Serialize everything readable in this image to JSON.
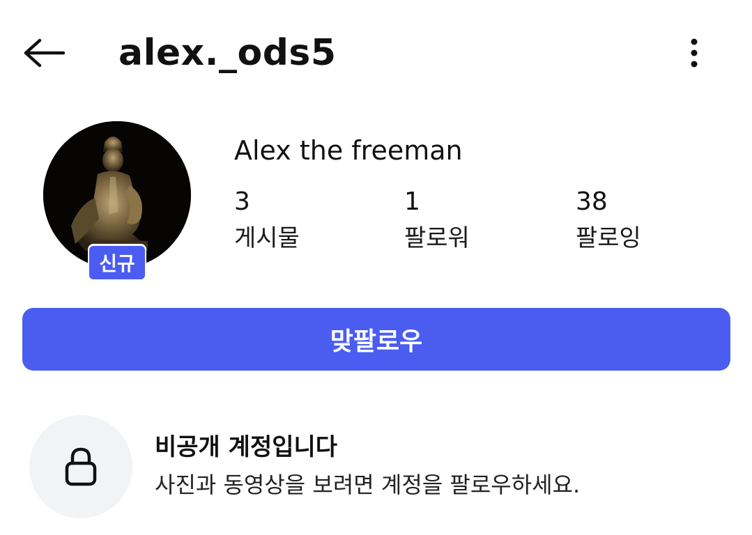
{
  "header": {
    "back_icon": "arrow-left-icon",
    "username": "alex._ods5",
    "more_icon": "vertical-ellipsis-icon"
  },
  "profile": {
    "display_name": "Alex the freeman",
    "new_badge": "신규",
    "stats": [
      {
        "count": "3",
        "label": "게시물"
      },
      {
        "count": "1",
        "label": "팔로워"
      },
      {
        "count": "38",
        "label": "팔로잉"
      }
    ]
  },
  "actions": {
    "follow_back_label": "맞팔로우"
  },
  "private_notice": {
    "icon": "lock-icon",
    "title": "비공개 계정입니다",
    "description": "사진과 동영상을 보려면 계정을 팔로우하세요."
  },
  "colors": {
    "accent": "#4a5df0",
    "lock_circle_bg": "#f2f3f4",
    "text": "#111111"
  }
}
